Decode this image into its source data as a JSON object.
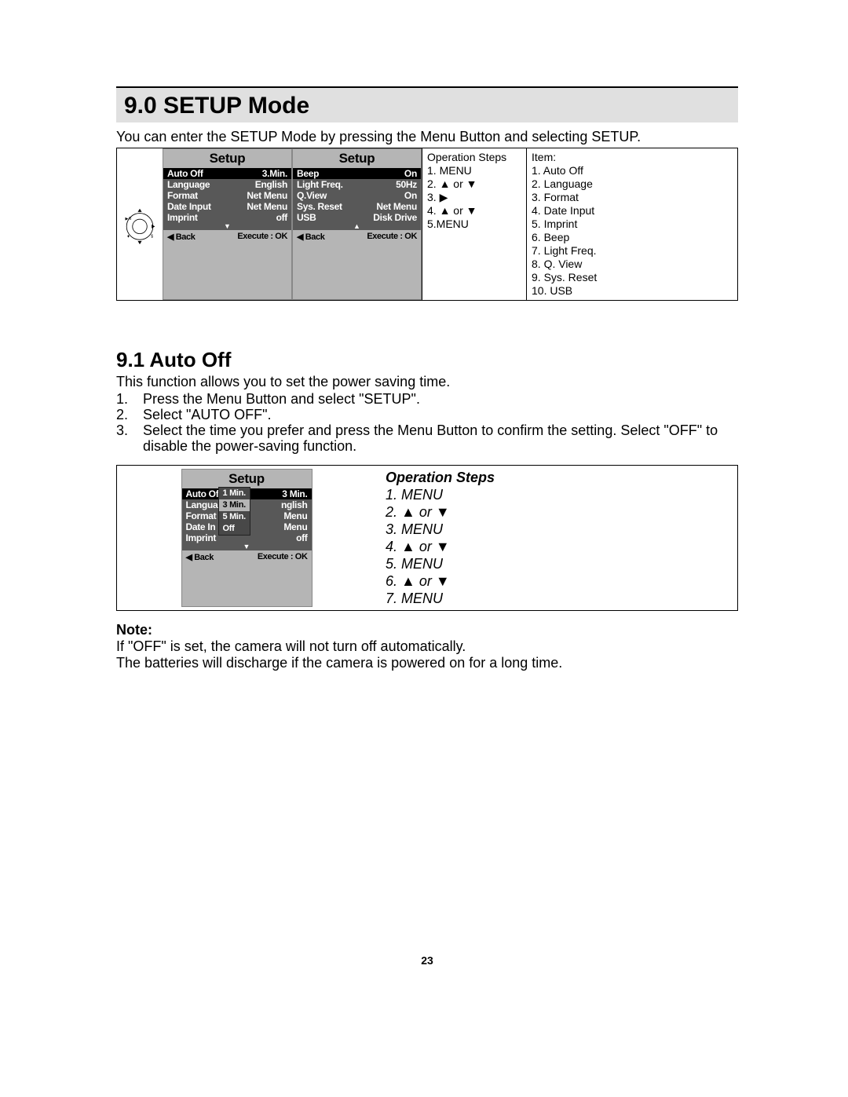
{
  "section_heading": "9.0  SETUP Mode",
  "intro": "You can enter the SETUP Mode by pressing the Menu Button and selecting SETUP.",
  "screen1": {
    "title": "Setup",
    "rows": [
      {
        "label": "Auto Off",
        "value": "3.Min."
      },
      {
        "label": "Language",
        "value": "English"
      },
      {
        "label": "Format",
        "value": "Net Menu"
      },
      {
        "label": "Date Input",
        "value": "Net Menu"
      },
      {
        "label": "Imprint",
        "value": "off"
      }
    ],
    "footer_left": "◀ Back",
    "footer_right": "Execute : OK"
  },
  "screen2": {
    "title": "Setup",
    "rows": [
      {
        "label": "Beep",
        "value": "On"
      },
      {
        "label": "Light Freq.",
        "value": "50Hz"
      },
      {
        "label": "Q.View",
        "value": "On"
      },
      {
        "label": "Sys. Reset",
        "value": "Net Menu"
      },
      {
        "label": "USB",
        "value": "Disk Drive"
      }
    ],
    "footer_left": "◀ Back",
    "footer_right": "Execute : OK"
  },
  "ops1": {
    "heading": "Operation Steps",
    "steps": [
      "1. MENU",
      "2. ▲ or ▼",
      "3. ▶",
      "4. ▲ or ▼",
      "5.MENU"
    ]
  },
  "item_list": {
    "heading": "Item:",
    "items": [
      "1.    Auto Off",
      "2.    Language",
      "3.    Format",
      "4.    Date Input",
      "5.    Imprint",
      "6.    Beep",
      "7.    Light Freq.",
      "8.    Q. View",
      "9.    Sys. Reset",
      "10.  USB"
    ]
  },
  "subheading": "9.1   Auto Off",
  "sub_intro": "This function allows you to set the power saving time.",
  "steps": [
    "Press the Menu Button and select \"SETUP\".",
    "Select \"AUTO OFF\".",
    "Select the time you prefer and press the Menu Button to confirm the setting. Select \"OFF\" to disable the power-saving function."
  ],
  "screen3": {
    "title": "Setup",
    "rows": [
      {
        "label": "Auto Off",
        "value": "3 Min."
      },
      {
        "label": "Langua",
        "value": "nglish"
      },
      {
        "label": "Format",
        "value": "Menu"
      },
      {
        "label": "Date In",
        "value": "Menu"
      },
      {
        "label": "Imprint",
        "value": "off"
      }
    ],
    "footer_left": "◀ Back",
    "footer_right": "Execute : OK",
    "popup": [
      "1 Min.",
      "3 Min.",
      "5 Min.",
      "Off"
    ]
  },
  "ops2": {
    "heading": "Operation Steps",
    "steps": [
      "1. MENU",
      "2. ▲ or ▼",
      "3. MENU",
      "4. ▲ or ▼",
      "5. MENU",
      "6. ▲ or ▼",
      "7. MENU"
    ]
  },
  "note_label": "Note:",
  "note_text1": "If \"OFF\" is set, the camera will not turn off automatically.",
  "note_text2": "The batteries will discharge if the camera is powered on for a long time.",
  "page_number": "23"
}
